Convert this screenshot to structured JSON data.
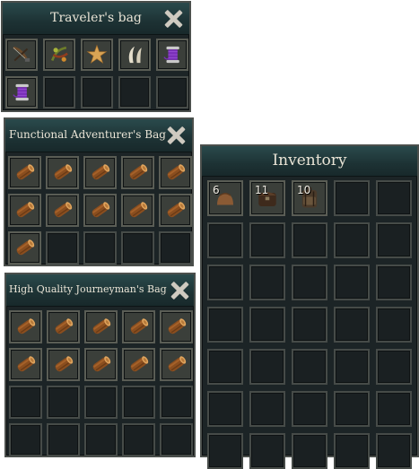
{
  "bags": [
    {
      "title": "Traveler's bag",
      "slots": [
        {
          "item": "crossbow-icon"
        },
        {
          "item": "herb-bundle-icon"
        },
        {
          "item": "starfish-icon"
        },
        {
          "item": "claws-icon"
        },
        {
          "item": "purple-thread-spool-icon"
        },
        {
          "item": "purple-thread-spool-icon"
        },
        {
          "item": null
        },
        {
          "item": null
        },
        {
          "item": null
        },
        {
          "item": null
        }
      ]
    },
    {
      "title": "Functional Adventurer's Bag",
      "slots": [
        {
          "item": "wood-log-icon"
        },
        {
          "item": "wood-log-icon"
        },
        {
          "item": "wood-log-icon"
        },
        {
          "item": "wood-log-icon"
        },
        {
          "item": "wood-log-icon"
        },
        {
          "item": "wood-log-icon"
        },
        {
          "item": "wood-log-icon"
        },
        {
          "item": "wood-log-icon"
        },
        {
          "item": "wood-log-icon"
        },
        {
          "item": "wood-log-icon"
        },
        {
          "item": "wood-log-icon"
        },
        {
          "item": null
        },
        {
          "item": null
        },
        {
          "item": null
        },
        {
          "item": null
        }
      ]
    },
    {
      "title": "High Quality Journeyman's Bag",
      "slots": [
        {
          "item": "wood-log-icon"
        },
        {
          "item": "wood-log-icon"
        },
        {
          "item": "wood-log-icon"
        },
        {
          "item": "wood-log-icon"
        },
        {
          "item": "wood-log-icon"
        },
        {
          "item": "wood-log-icon"
        },
        {
          "item": "wood-log-icon"
        },
        {
          "item": "wood-log-icon"
        },
        {
          "item": "wood-log-icon"
        },
        {
          "item": "wood-log-icon"
        },
        {
          "item": null
        },
        {
          "item": null
        },
        {
          "item": null
        },
        {
          "item": null
        },
        {
          "item": null
        },
        {
          "item": null
        },
        {
          "item": null
        },
        {
          "item": null
        },
        {
          "item": null
        },
        {
          "item": null
        }
      ]
    }
  ],
  "inventory": {
    "title": "Inventory",
    "slots": [
      {
        "item": "leather-pouch-icon",
        "count": "6"
      },
      {
        "item": "leather-satchel-icon",
        "count": "11"
      },
      {
        "item": "leather-backpack-icon",
        "count": "10"
      },
      {
        "item": null
      },
      {
        "item": null
      },
      {
        "item": null
      },
      {
        "item": null
      },
      {
        "item": null
      },
      {
        "item": null
      },
      {
        "item": null
      },
      {
        "item": null
      },
      {
        "item": null
      },
      {
        "item": null
      },
      {
        "item": null
      },
      {
        "item": null
      },
      {
        "item": null
      },
      {
        "item": null
      },
      {
        "item": null
      },
      {
        "item": null
      },
      {
        "item": null
      },
      {
        "item": null
      },
      {
        "item": null
      },
      {
        "item": null
      },
      {
        "item": null
      },
      {
        "item": null
      },
      {
        "item": null
      },
      {
        "item": null
      },
      {
        "item": null
      },
      {
        "item": null
      },
      {
        "item": null
      },
      {
        "item": null
      },
      {
        "item": null
      },
      {
        "item": null
      },
      {
        "item": null
      },
      {
        "item": null
      }
    ]
  },
  "colors": {
    "panel_bg": "#1c2426",
    "header_teal": "#1d3234",
    "slot_border": "#464b48",
    "title_text": "#e9e4d6"
  }
}
